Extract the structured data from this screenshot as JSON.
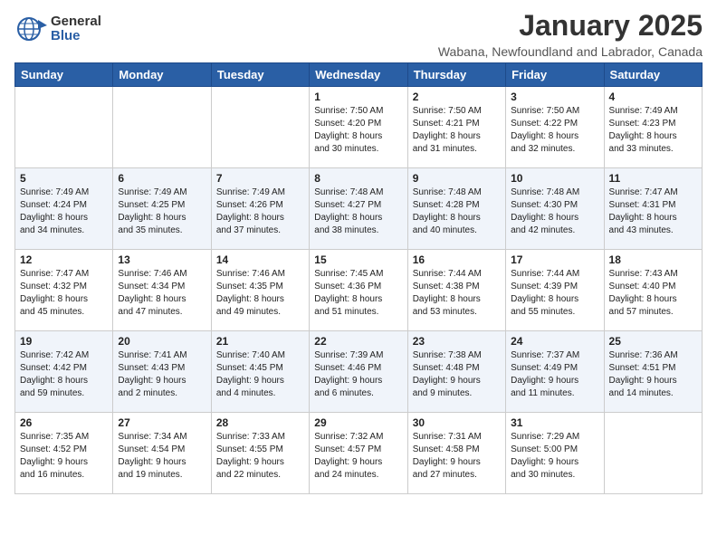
{
  "header": {
    "logo_general": "General",
    "logo_blue": "Blue",
    "main_title": "January 2025",
    "subtitle": "Wabana, Newfoundland and Labrador, Canada"
  },
  "calendar": {
    "headers": [
      "Sunday",
      "Monday",
      "Tuesday",
      "Wednesday",
      "Thursday",
      "Friday",
      "Saturday"
    ],
    "weeks": [
      [
        {
          "day": "",
          "info": ""
        },
        {
          "day": "",
          "info": ""
        },
        {
          "day": "",
          "info": ""
        },
        {
          "day": "1",
          "info": "Sunrise: 7:50 AM\nSunset: 4:20 PM\nDaylight: 8 hours\nand 30 minutes."
        },
        {
          "day": "2",
          "info": "Sunrise: 7:50 AM\nSunset: 4:21 PM\nDaylight: 8 hours\nand 31 minutes."
        },
        {
          "day": "3",
          "info": "Sunrise: 7:50 AM\nSunset: 4:22 PM\nDaylight: 8 hours\nand 32 minutes."
        },
        {
          "day": "4",
          "info": "Sunrise: 7:49 AM\nSunset: 4:23 PM\nDaylight: 8 hours\nand 33 minutes."
        }
      ],
      [
        {
          "day": "5",
          "info": "Sunrise: 7:49 AM\nSunset: 4:24 PM\nDaylight: 8 hours\nand 34 minutes."
        },
        {
          "day": "6",
          "info": "Sunrise: 7:49 AM\nSunset: 4:25 PM\nDaylight: 8 hours\nand 35 minutes."
        },
        {
          "day": "7",
          "info": "Sunrise: 7:49 AM\nSunset: 4:26 PM\nDaylight: 8 hours\nand 37 minutes."
        },
        {
          "day": "8",
          "info": "Sunrise: 7:48 AM\nSunset: 4:27 PM\nDaylight: 8 hours\nand 38 minutes."
        },
        {
          "day": "9",
          "info": "Sunrise: 7:48 AM\nSunset: 4:28 PM\nDaylight: 8 hours\nand 40 minutes."
        },
        {
          "day": "10",
          "info": "Sunrise: 7:48 AM\nSunset: 4:30 PM\nDaylight: 8 hours\nand 42 minutes."
        },
        {
          "day": "11",
          "info": "Sunrise: 7:47 AM\nSunset: 4:31 PM\nDaylight: 8 hours\nand 43 minutes."
        }
      ],
      [
        {
          "day": "12",
          "info": "Sunrise: 7:47 AM\nSunset: 4:32 PM\nDaylight: 8 hours\nand 45 minutes."
        },
        {
          "day": "13",
          "info": "Sunrise: 7:46 AM\nSunset: 4:34 PM\nDaylight: 8 hours\nand 47 minutes."
        },
        {
          "day": "14",
          "info": "Sunrise: 7:46 AM\nSunset: 4:35 PM\nDaylight: 8 hours\nand 49 minutes."
        },
        {
          "day": "15",
          "info": "Sunrise: 7:45 AM\nSunset: 4:36 PM\nDaylight: 8 hours\nand 51 minutes."
        },
        {
          "day": "16",
          "info": "Sunrise: 7:44 AM\nSunset: 4:38 PM\nDaylight: 8 hours\nand 53 minutes."
        },
        {
          "day": "17",
          "info": "Sunrise: 7:44 AM\nSunset: 4:39 PM\nDaylight: 8 hours\nand 55 minutes."
        },
        {
          "day": "18",
          "info": "Sunrise: 7:43 AM\nSunset: 4:40 PM\nDaylight: 8 hours\nand 57 minutes."
        }
      ],
      [
        {
          "day": "19",
          "info": "Sunrise: 7:42 AM\nSunset: 4:42 PM\nDaylight: 8 hours\nand 59 minutes."
        },
        {
          "day": "20",
          "info": "Sunrise: 7:41 AM\nSunset: 4:43 PM\nDaylight: 9 hours\nand 2 minutes."
        },
        {
          "day": "21",
          "info": "Sunrise: 7:40 AM\nSunset: 4:45 PM\nDaylight: 9 hours\nand 4 minutes."
        },
        {
          "day": "22",
          "info": "Sunrise: 7:39 AM\nSunset: 4:46 PM\nDaylight: 9 hours\nand 6 minutes."
        },
        {
          "day": "23",
          "info": "Sunrise: 7:38 AM\nSunset: 4:48 PM\nDaylight: 9 hours\nand 9 minutes."
        },
        {
          "day": "24",
          "info": "Sunrise: 7:37 AM\nSunset: 4:49 PM\nDaylight: 9 hours\nand 11 minutes."
        },
        {
          "day": "25",
          "info": "Sunrise: 7:36 AM\nSunset: 4:51 PM\nDaylight: 9 hours\nand 14 minutes."
        }
      ],
      [
        {
          "day": "26",
          "info": "Sunrise: 7:35 AM\nSunset: 4:52 PM\nDaylight: 9 hours\nand 16 minutes."
        },
        {
          "day": "27",
          "info": "Sunrise: 7:34 AM\nSunset: 4:54 PM\nDaylight: 9 hours\nand 19 minutes."
        },
        {
          "day": "28",
          "info": "Sunrise: 7:33 AM\nSunset: 4:55 PM\nDaylight: 9 hours\nand 22 minutes."
        },
        {
          "day": "29",
          "info": "Sunrise: 7:32 AM\nSunset: 4:57 PM\nDaylight: 9 hours\nand 24 minutes."
        },
        {
          "day": "30",
          "info": "Sunrise: 7:31 AM\nSunset: 4:58 PM\nDaylight: 9 hours\nand 27 minutes."
        },
        {
          "day": "31",
          "info": "Sunrise: 7:29 AM\nSunset: 5:00 PM\nDaylight: 9 hours\nand 30 minutes."
        },
        {
          "day": "",
          "info": ""
        }
      ]
    ]
  }
}
